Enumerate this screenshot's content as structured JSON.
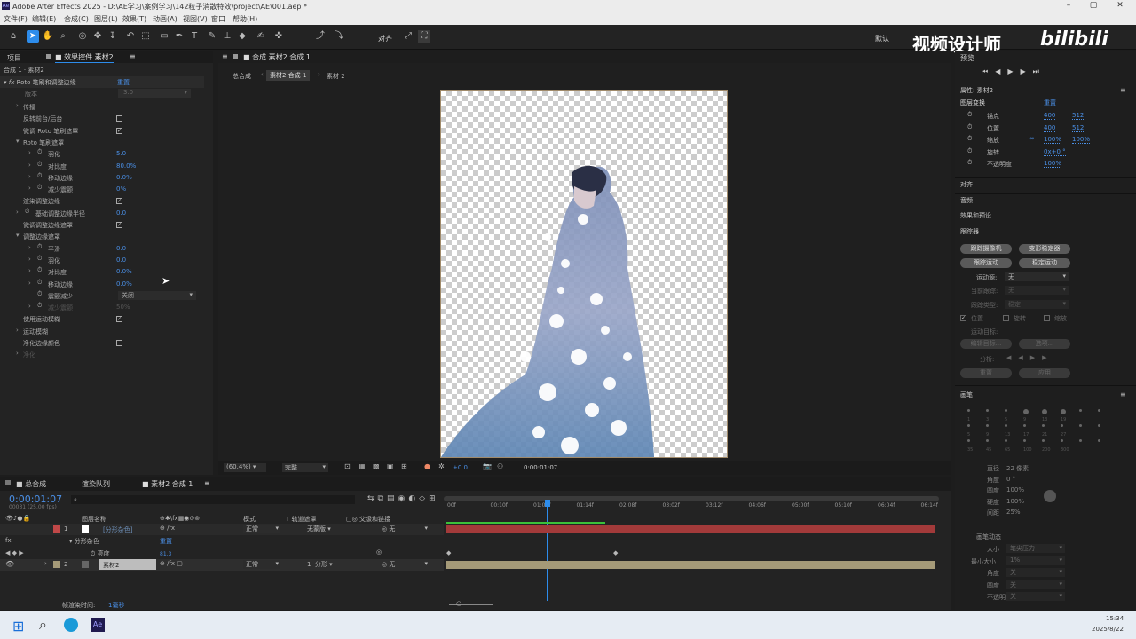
{
  "window": {
    "title": "Adobe After Effects 2025 - D:\\AE学习\\案例学习\\142粒子消散特效\\project\\AE\\001.aep *",
    "icon": "ae-icon"
  },
  "menu": [
    "文件(F)",
    "编辑(E)",
    "合成(C)",
    "图层(L)",
    "效果(T)",
    "动画(A)",
    "视图(V)",
    "窗口",
    "帮助(H)"
  ],
  "toolbar": {
    "align": "对齐",
    "workspace": "默认",
    "brand": "视频设计师",
    "site": "bilibili"
  },
  "left_tabs": {
    "project": "项目",
    "effects": "效果控件 素材2"
  },
  "breadcrumb": "合成 1 · 素材2",
  "effect": {
    "name": "Roto 笔刷和调整边缘",
    "reset": "重置",
    "version_label": "版本",
    "version": "3.0",
    "rows": [
      {
        "label": "传播",
        "indent": 1,
        "tri": true
      },
      {
        "label": "反转前台/后台",
        "indent": 1,
        "check": false
      },
      {
        "label": "微调 Roto 笔刷遮罩",
        "indent": 1,
        "check": true
      },
      {
        "label": "Roto 笔刷遮罩",
        "indent": 1,
        "tri": true,
        "open": true
      },
      {
        "label": "羽化",
        "indent": 2,
        "tri": true,
        "stop": true,
        "value": "5.0"
      },
      {
        "label": "对比度",
        "indent": 2,
        "tri": true,
        "stop": true,
        "value": "80.0%"
      },
      {
        "label": "移动边缘",
        "indent": 2,
        "tri": true,
        "stop": true,
        "value": "0.0%"
      },
      {
        "label": "减少震颤",
        "indent": 2,
        "tri": true,
        "stop": true,
        "value": "0%"
      },
      {
        "label": "渲染调整边缘",
        "indent": 1,
        "check": true
      },
      {
        "label": "基础调整边缘半径",
        "indent": 1,
        "tri": true,
        "stop": true,
        "value": "0.0"
      },
      {
        "label": "微调调整边缘遮罩",
        "indent": 1,
        "check": true
      },
      {
        "label": "调整边缘遮罩",
        "indent": 1,
        "tri": true,
        "open": true
      },
      {
        "label": "平滑",
        "indent": 2,
        "tri": true,
        "stop": true,
        "value": "0.0"
      },
      {
        "label": "羽化",
        "indent": 2,
        "tri": true,
        "stop": true,
        "value": "0.0"
      },
      {
        "label": "对比度",
        "indent": 2,
        "tri": true,
        "stop": true,
        "value": "0.0%"
      },
      {
        "label": "移动边缘",
        "indent": 2,
        "tri": true,
        "stop": true,
        "value": "0.0%"
      },
      {
        "label": "震颤减少",
        "indent": 2,
        "stop": true,
        "dropdown": "关闭"
      },
      {
        "label": "减少震颤",
        "indent": 2,
        "tri": true,
        "stop": true,
        "value": "50%",
        "dim": true
      },
      {
        "label": "使用运动模糊",
        "indent": 1,
        "check": true
      },
      {
        "label": "运动模糊",
        "indent": 1,
        "tri": true
      },
      {
        "label": "净化边缘颜色",
        "indent": 1,
        "check": false
      },
      {
        "label": "净化",
        "indent": 1,
        "tri": true,
        "dim": true
      }
    ]
  },
  "comp": {
    "tab": "合成 素材2 合成 1",
    "crumbs": [
      "总合成",
      "素材2 合成 1",
      "素材 2"
    ],
    "zoom": "(60.4%)",
    "quality": "完整",
    "exposure": "+0.0",
    "timecode": "0:00:01:07"
  },
  "right": {
    "preview": "预览",
    "props_title": "属性: 素材2",
    "transform": "图层变换",
    "reset": "重置",
    "props": [
      {
        "label": "锚点",
        "v1": "400",
        "v2": "512"
      },
      {
        "label": "位置",
        "v1": "400",
        "v2": "512"
      },
      {
        "label": "缩放",
        "v1": "100%",
        "v2": "100%"
      },
      {
        "label": "旋转",
        "v1": "0x+0 °",
        "v2": ""
      },
      {
        "label": "不透明度",
        "v1": "100%",
        "v2": ""
      }
    ],
    "sections": [
      "对齐",
      "音频",
      "效果和预设",
      "跟踪器"
    ],
    "tracker_btns": [
      "跟踪摄像机",
      "变形稳定器",
      "跟踪运动",
      "稳定运动"
    ],
    "motion_source": "运动源:",
    "motion_source_val": "无",
    "current_track": "当前跟踪:",
    "track_type": "跟踪类型:",
    "track_type_val": "稳定",
    "checks": [
      "位置",
      "旋转",
      "缩放"
    ],
    "motion_target": "运动目标:",
    "edit_target": "编辑目标...",
    "options": "选项...",
    "analyze": "分析:",
    "reset_btn": "重置",
    "apply": "应用",
    "brushes": "画笔",
    "brush_nums": [
      "1",
      "3",
      "5",
      "9",
      "13",
      "19",
      "5",
      "9",
      "13",
      "17",
      "21",
      "27",
      "35",
      "45",
      "65",
      "100",
      "200",
      "300"
    ],
    "brush_props": [
      {
        "label": "直径",
        "value": "22 像素"
      },
      {
        "label": "角度",
        "value": "0 °"
      },
      {
        "label": "圆度",
        "value": "100%"
      },
      {
        "label": "硬度",
        "value": "100%"
      },
      {
        "label": "间距",
        "value": "25%"
      }
    ],
    "brush_dyn": "画笔动态",
    "brush_dyn_rows": [
      {
        "label": "大小",
        "value": "笔尖压力"
      },
      {
        "label": "最小大小",
        "value": "1%"
      },
      {
        "label": "角度",
        "value": "关"
      },
      {
        "label": "圆度",
        "value": "关"
      },
      {
        "label": "不透明度",
        "value": "关"
      }
    ]
  },
  "timeline": {
    "tabs": [
      "总合成",
      "渲染队列",
      "素材2 合成 1"
    ],
    "timecode": "0:00:01:07",
    "fps": "00031 (25.00 fps)",
    "cols": {
      "name": "图层名称",
      "mode": "模式",
      "trkmat": "T  轨道遮罩",
      "parent": "父级和链接"
    },
    "ruler": [
      "00f",
      "00:10f",
      "01:04f",
      "01:14f",
      "02:08f",
      "03:02f",
      "03:12f",
      "04:06f",
      "05:00f",
      "05:10f",
      "06:04f",
      "06:14f"
    ],
    "layers": [
      {
        "num": "1",
        "name": "[分形杂色]",
        "mode": "正常",
        "mat": "无蒙版",
        "parent": "无"
      },
      {
        "num": "2",
        "name": "素材2",
        "mode": "正常",
        "mat": "1. 分形",
        "parent": "无"
      }
    ],
    "sub": {
      "effect": "分形杂色",
      "reset": "重置",
      "prop": "亮度",
      "value": "81.3"
    },
    "footer": {
      "label": "帧渲染时间:",
      "value": "1毫秒"
    }
  },
  "taskbar": {
    "time": "15:34",
    "date": "2025/8/22"
  }
}
